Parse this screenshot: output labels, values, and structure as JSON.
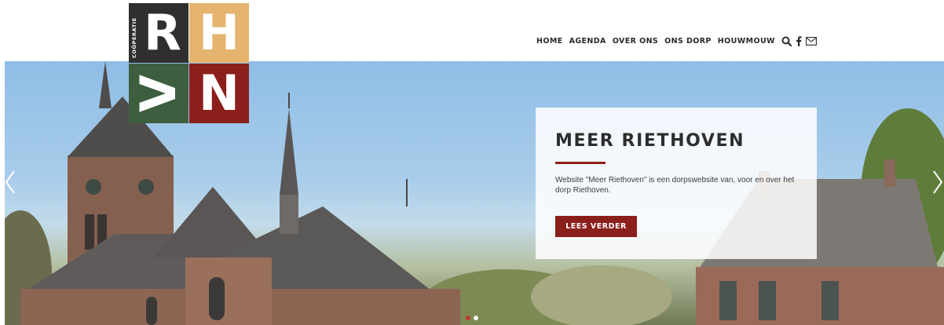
{
  "logo": {
    "letters": [
      "R",
      "H",
      "V",
      "N"
    ],
    "side_text": "COÖPERATIE",
    "colors": {
      "r": "#2f2f2f",
      "h": "#e5b46e",
      "v": "#3d5e3f",
      "n": "#8b1f1b"
    }
  },
  "nav": {
    "items": [
      {
        "label": "HOME"
      },
      {
        "label": "AGENDA"
      },
      {
        "label": "OVER ONS"
      },
      {
        "label": "ONS DORP"
      },
      {
        "label": "HOUWMOUW"
      }
    ],
    "icons": [
      "search-icon",
      "facebook-icon",
      "mail-icon"
    ]
  },
  "hero": {
    "card": {
      "title": "MEER RIETHOVEN",
      "text": "Website \"Meer Riethoven\" is een dorpswebsite van, voor en over het dorp Riethoven.",
      "button_label": "LEES VERDER"
    },
    "slides_total": 2,
    "active_slide": 1
  },
  "colors": {
    "accent": "#8b1f1b",
    "nav_text": "#2a2a2a",
    "dot_active": "#c0392b"
  }
}
